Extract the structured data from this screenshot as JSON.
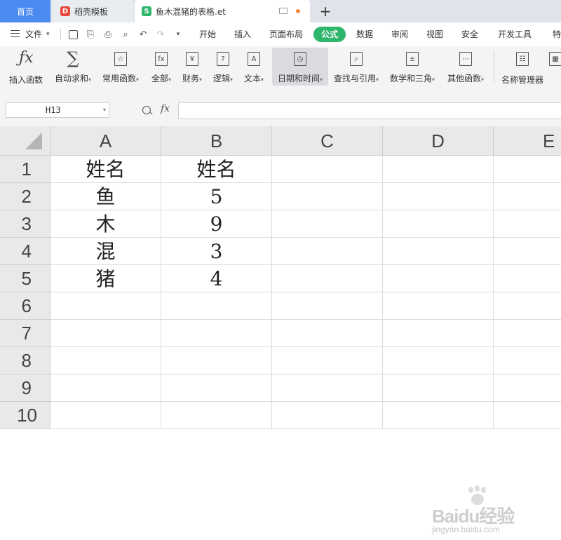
{
  "tabs": {
    "home": "首页",
    "docer": "稻壳模板",
    "document": "鱼木混猪的表格.et",
    "docer_icon_text": "D",
    "doc_icon_text": "S",
    "add": "+"
  },
  "menu": {
    "file": "文件",
    "items": [
      "开始",
      "插入",
      "页面布局",
      "公式",
      "数据",
      "审阅",
      "视图",
      "安全",
      "开发工具",
      "特"
    ],
    "active": "公式",
    "accent_color": "#2fb66d"
  },
  "ribbon": {
    "buttons": [
      {
        "label": "插入函数",
        "icon": "fx-icon"
      },
      {
        "label": "自动求和",
        "icon": "sigma-icon",
        "dropdown": true
      },
      {
        "label": "常用函数",
        "icon": "star-function-icon",
        "dropdown": true
      },
      {
        "label": "全部",
        "icon": "all-functions-icon",
        "dropdown": true
      },
      {
        "label": "财务",
        "icon": "finance-icon",
        "dropdown": true
      },
      {
        "label": "逻辑",
        "icon": "logic-icon",
        "dropdown": true
      },
      {
        "label": "文本",
        "icon": "text-icon",
        "dropdown": true
      },
      {
        "label": "日期和时间",
        "icon": "clock-icon",
        "dropdown": true
      },
      {
        "label": "查找与引用",
        "icon": "lookup-icon",
        "dropdown": true
      },
      {
        "label": "数学和三角",
        "icon": "math-icon",
        "dropdown": true
      },
      {
        "label": "其他函数",
        "icon": "more-functions-icon",
        "dropdown": true
      },
      {
        "label": "名称管理器",
        "icon": "name-manager-icon"
      }
    ],
    "icon_glyphs": {
      "all": "fx",
      "finance": "¥",
      "logic": "?",
      "text": "A"
    }
  },
  "formula_bar": {
    "cell_ref": "H13",
    "fx": "fx",
    "formula": ""
  },
  "sheet": {
    "columns": [
      "A",
      "B",
      "C",
      "D",
      "E"
    ],
    "rows": [
      "1",
      "2",
      "3",
      "4",
      "5",
      "6",
      "7",
      "8",
      "9",
      "10"
    ],
    "cells": [
      [
        "姓名",
        "姓名"
      ],
      [
        "鱼",
        "5"
      ],
      [
        "木",
        "9"
      ],
      [
        "混",
        "3"
      ],
      [
        "猪",
        "4"
      ]
    ]
  },
  "watermark": {
    "brand": "Baidu经验",
    "url": "jingyan.baidu.com"
  }
}
